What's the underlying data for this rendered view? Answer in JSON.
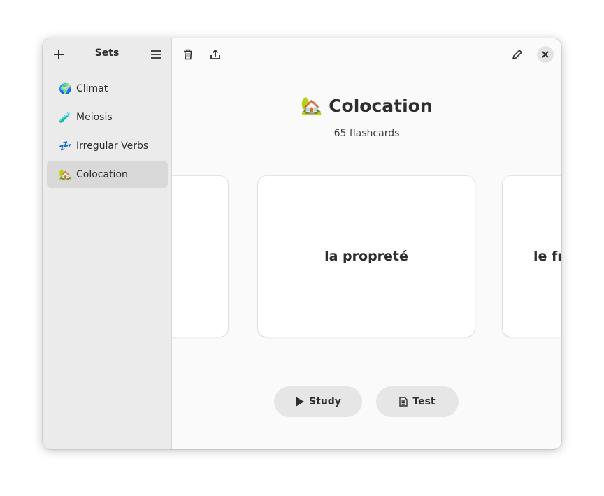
{
  "sidebar": {
    "title": "Sets",
    "items": [
      {
        "emoji": "🌍",
        "label": "Climat"
      },
      {
        "emoji": "🧪",
        "label": "Meiosis"
      },
      {
        "emoji": "💤",
        "label": "Irregular Verbs"
      },
      {
        "emoji": "🏡",
        "label": "Colocation",
        "selected": true
      }
    ]
  },
  "main": {
    "emoji": "🏡",
    "title": "Colocation",
    "count": "65 flashcards",
    "cards": {
      "prev": "",
      "current": "la propreté",
      "next": "le frigo"
    },
    "study_label": "Study",
    "test_label": "Test"
  }
}
